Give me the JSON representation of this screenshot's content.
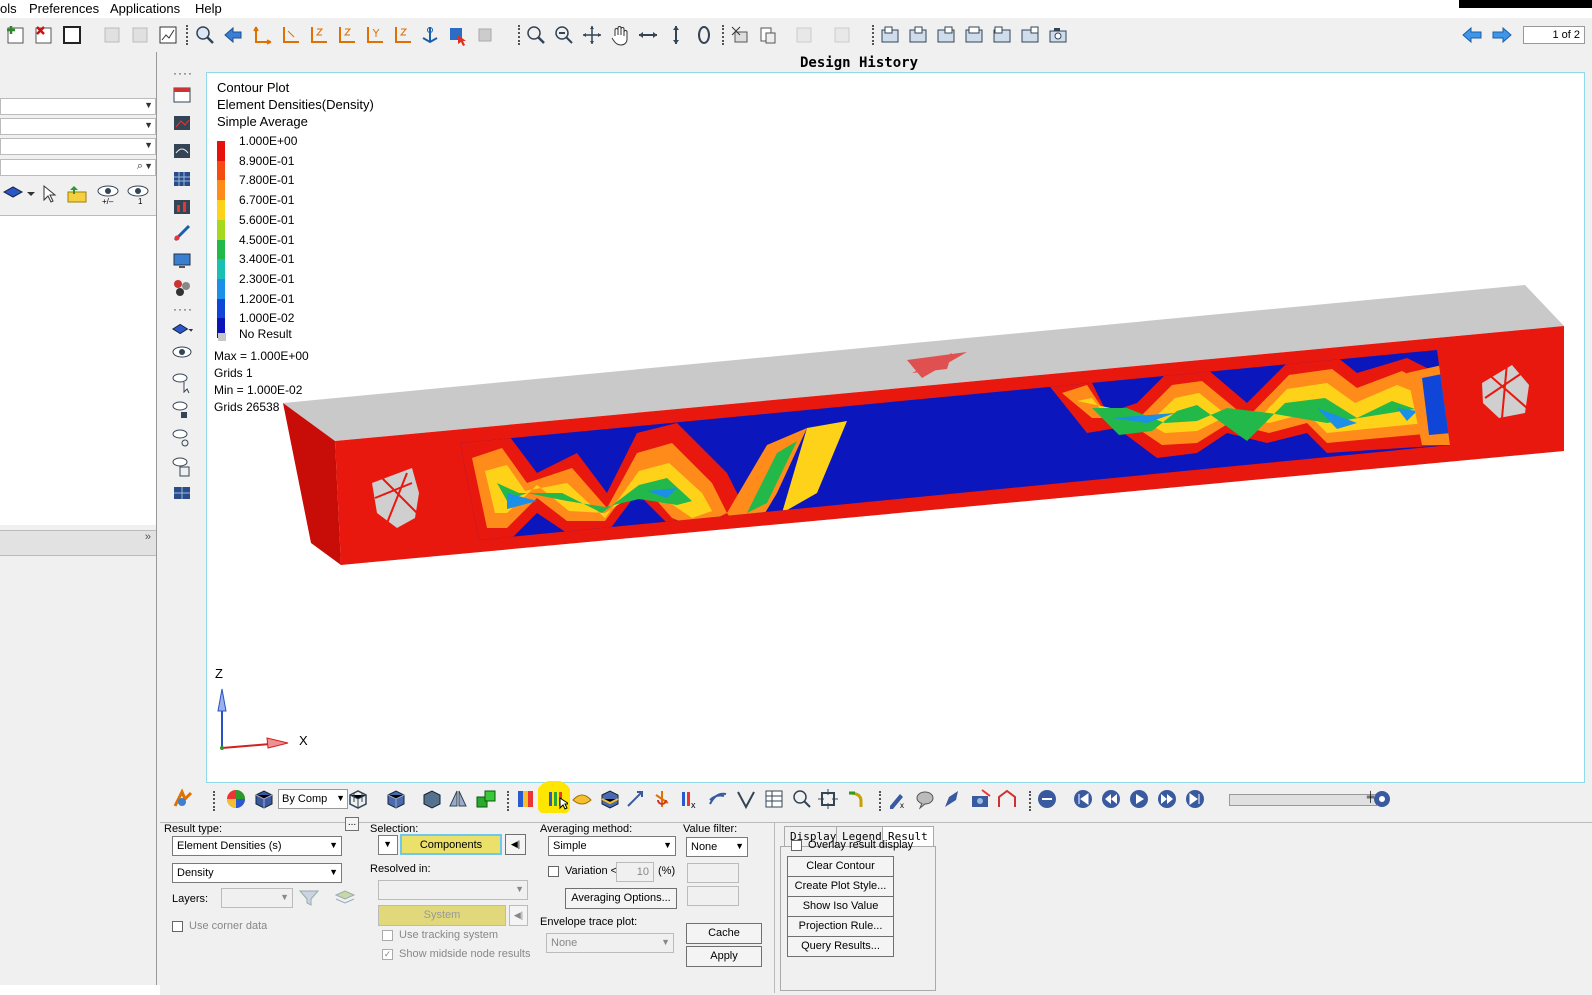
{
  "menu": {
    "items": [
      "ols",
      "Preferences",
      "Applications",
      "Help"
    ]
  },
  "page_indicator": "1 of 2",
  "view": {
    "title": "Design History",
    "legend": {
      "title": "Contour Plot",
      "subtitle": "Element Densities(Density)",
      "averaging": "Simple Average",
      "entries": [
        {
          "label": "1.000E+00",
          "color": "#e8100a"
        },
        {
          "label": "8.900E-01",
          "color": "#f54a10"
        },
        {
          "label": "7.800E-01",
          "color": "#ff8c1a"
        },
        {
          "label": "6.700E-01",
          "color": "#ffd21a"
        },
        {
          "label": "5.600E-01",
          "color": "#a6d81f"
        },
        {
          "label": "4.500E-01",
          "color": "#22b84a"
        },
        {
          "label": "3.400E-01",
          "color": "#18c0b4"
        },
        {
          "label": "2.300E-01",
          "color": "#1c8fe6"
        },
        {
          "label": "1.200E-01",
          "color": "#1046d8"
        },
        {
          "label": "1.000E-02",
          "color": "#0a14b8"
        }
      ],
      "no_result": "No Result",
      "max": "Max = 1.000E+00",
      "max_grids": "Grids 1",
      "min": "Min = 1.000E-02",
      "min_grids": "Grids 26538"
    },
    "axes": {
      "z": "Z",
      "x": "X"
    }
  },
  "bottom_toolbar": {
    "by_comp": "By Comp"
  },
  "result_panel": {
    "result_type_label": "Result type:",
    "result_type_value": "Element Densities (s)",
    "component_value": "Density",
    "layers_label": "Layers:",
    "use_corner_data": "Use corner data",
    "more_button": "...",
    "selection_label": "Selection:",
    "components_button": "Components",
    "resolved_in_label": "Resolved in:",
    "system_button": "System",
    "use_tracking_system": "Use tracking system",
    "show_midside": "Show midside node results",
    "averaging_method_label": "Averaging method:",
    "averaging_method_value": "Simple",
    "variation_label": "Variation <",
    "variation_value": "10",
    "variation_unit": "(%)",
    "averaging_options": "Averaging Options...",
    "envelope_label": "Envelope trace plot:",
    "envelope_value": "None",
    "value_filter_label": "Value filter:",
    "value_filter_value": "None",
    "cache_button": "Cache",
    "apply_button": "Apply",
    "tabs": [
      "Display",
      "Legend",
      "Result"
    ],
    "overlay": "Overlay result display",
    "buttons": [
      "Clear Contour",
      "Create Plot Style...",
      "Show Iso Value",
      "Projection Rule...",
      "Query Results..."
    ]
  }
}
